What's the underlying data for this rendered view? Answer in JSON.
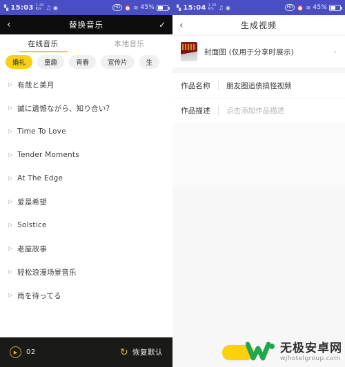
{
  "left": {
    "statusbar": {
      "time": "15:03",
      "signal_icon": "signal-icon",
      "data_speed": "1.20",
      "data_unit": "K/s",
      "music_icon": "music-note-icon",
      "nfc_icon": "nfc-icon",
      "hd_badge": "HD",
      "alarm_icon": "alarm-icon",
      "wifi_icon": "wifi-icon",
      "battery_percent": "45%",
      "battery_icon": "battery-icon"
    },
    "nav": {
      "back_icon": "chevron-left-icon",
      "title": "替换音乐",
      "confirm_icon": "check-icon"
    },
    "tabs": [
      {
        "label": "在线音乐",
        "active": true
      },
      {
        "label": "本地音乐",
        "active": false
      }
    ],
    "chips": [
      {
        "label": "婚礼",
        "selected": true
      },
      {
        "label": "童趣",
        "selected": false
      },
      {
        "label": "青春",
        "selected": false
      },
      {
        "label": "宣传片",
        "selected": false
      },
      {
        "label": "生",
        "selected": false
      }
    ],
    "songs": [
      {
        "name": "有哉と美月"
      },
      {
        "name": "誠に遺憾ながら、知り合い?"
      },
      {
        "name": "Time To Love"
      },
      {
        "name": "Tender Moments"
      },
      {
        "name": "At The Edge"
      },
      {
        "name": "爱是希望"
      },
      {
        "name": "Solstice"
      },
      {
        "name": "老屋故事"
      },
      {
        "name": "轻松浪漫场景音乐"
      },
      {
        "name": "雨を待ってる"
      }
    ],
    "bottom": {
      "play_icon": "play-icon",
      "count": "02",
      "reset_icon": "restore-icon",
      "reset_label": "恢复默认"
    }
  },
  "right": {
    "statusbar": {
      "time": "15:04",
      "signal_icon": "signal-icon",
      "data_speed": "1.20",
      "data_unit": "K/s",
      "music_icon": "music-note-icon",
      "nfc_icon": "nfc-icon",
      "hd_badge": "HD",
      "alarm_icon": "alarm-icon",
      "wifi_icon": "wifi-icon",
      "battery_percent": "45%",
      "battery_icon": "battery-icon"
    },
    "nav": {
      "back_icon": "chevron-left-icon",
      "title": "生成视频"
    },
    "cover": {
      "thumbnail_icon": "cover-thumbnail",
      "label": "封面图 (仅用于分享时展示)",
      "chevron_icon": "chevron-right-icon"
    },
    "fields": [
      {
        "label": "作品名称",
        "value": "朋友圈追债搞怪视频",
        "is_placeholder": false
      },
      {
        "label": "作品描述",
        "value": "点击添加作品描述",
        "is_placeholder": true
      }
    ]
  },
  "watermark": {
    "logo_icon": "w-logo-icon",
    "name": "无极安卓网",
    "url": "wjhotelgroup.com"
  },
  "colors": {
    "status_bar": "#4a4ec4",
    "accent_yellow": "#f7d117",
    "dark_nav": "#0d0d0d",
    "bottom_bar": "#1a1a18",
    "gold": "#e0b830",
    "logo_green": "#21a84c"
  }
}
